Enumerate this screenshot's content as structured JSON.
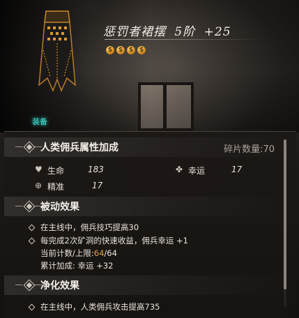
{
  "item": {
    "name": "惩罚者裙摆",
    "rank": "5阶",
    "enhance": "+25",
    "star_count": 4,
    "star_glyph": "$",
    "tag": "装备"
  },
  "attributes": {
    "title": "人类佣兵属性加成",
    "shard_label": "碎片数量:",
    "shard_value": "70",
    "stats": [
      {
        "icon": "heart-icon",
        "label": "生命",
        "value": "183"
      },
      {
        "icon": "clover-icon",
        "label": "幸运",
        "value": "17"
      },
      {
        "icon": "crosshair-icon",
        "label": "精准",
        "value": "17"
      }
    ]
  },
  "passive": {
    "title": "被动效果",
    "lines": [
      "在主线中，佣兵技巧提高30",
      "每完成2次矿洞的快速收益，佣兵幸运 +1"
    ],
    "count_label": "当前计数/上限:",
    "count_current": "64",
    "count_max": "/64",
    "total_label": "累计加成: 幸运 +32"
  },
  "purify": {
    "title": "净化效果",
    "lines": [
      "在主线中，人类佣兵攻击提高735"
    ]
  },
  "colors": {
    "accent": "#e6a44a",
    "tag": "#3fe0d0"
  }
}
